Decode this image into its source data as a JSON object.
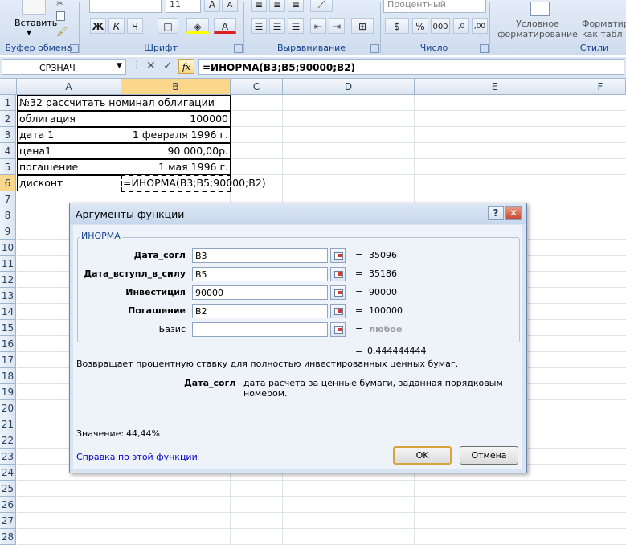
{
  "ribbon": {
    "clipboard_label": "Буфер обмена",
    "paste_label": "Вставить",
    "font_group_label": "Шрифт",
    "font_size": "11",
    "bold": "Ж",
    "italic": "К",
    "underline": "Ч",
    "align_group_label": "Выравнивание",
    "number_group_label": "Число",
    "number_format": "Процентный",
    "percent": "%",
    "thousands": "000",
    "styles_group_label": "Стили",
    "cond_format_line1": "Условное",
    "cond_format_line2": "форматирование",
    "format_table_line1": "Форматир",
    "format_table_line2": "как табл"
  },
  "formula_bar": {
    "name_box": "СРЗНАЧ",
    "fx": "fx",
    "formula": "=ИНОРМА(B3;B5;90000;B2)"
  },
  "columns": [
    "A",
    "B",
    "C",
    "D",
    "E",
    "F"
  ],
  "rows": [
    "1",
    "2",
    "3",
    "4",
    "5",
    "6",
    "7",
    "8",
    "9",
    "10",
    "11",
    "12",
    "13",
    "14",
    "15",
    "16",
    "17",
    "18",
    "19",
    "20",
    "21",
    "22",
    "23",
    "24",
    "25",
    "26",
    "27",
    "28"
  ],
  "cells": {
    "a1": "№32 рассчитать номинал облигации",
    "a2": "облигация",
    "b2": "100000",
    "a3": "дата 1",
    "b3": "1 февраля 1996 г.",
    "a4": "цена1",
    "b4": "90 000,00р.",
    "a5": "погашение",
    "b5": "1 мая 1996 г.",
    "a6": "дисконт",
    "b6": "=ИНОРМА(B3;B5;90000;B2)"
  },
  "dialog": {
    "title": "Аргументы функции",
    "help_btn": "?",
    "close_btn": "✕",
    "function_name": "ИНОРМА",
    "args": [
      {
        "label": "Дата_согл",
        "value": "B3",
        "result": "35096"
      },
      {
        "label": "Дата_вступл_в_силу",
        "value": "B5",
        "result": "35186"
      },
      {
        "label": "Инвестиция",
        "value": "90000",
        "result": "90000"
      },
      {
        "label": "Погашение",
        "value": "B2",
        "result": "100000"
      },
      {
        "label": "Базис",
        "value": "",
        "result": "любое"
      }
    ],
    "eq": "=",
    "total_result": "0,444444444",
    "description": "Возвращает процентную ставку для полностью инвестированных ценных бумаг.",
    "arg_name": "Дата_согл",
    "arg_description": "дата расчета за ценные бумаги, заданная порядковым номером.",
    "value_label": "Значение:",
    "value": "44,44%",
    "help_link": "Справка по этой функции",
    "ok": "OK",
    "cancel": "Отмена"
  },
  "colors": {
    "ribbon_text": "#15428b",
    "selected_header": "#fbd78c",
    "link": "#0000cc"
  }
}
